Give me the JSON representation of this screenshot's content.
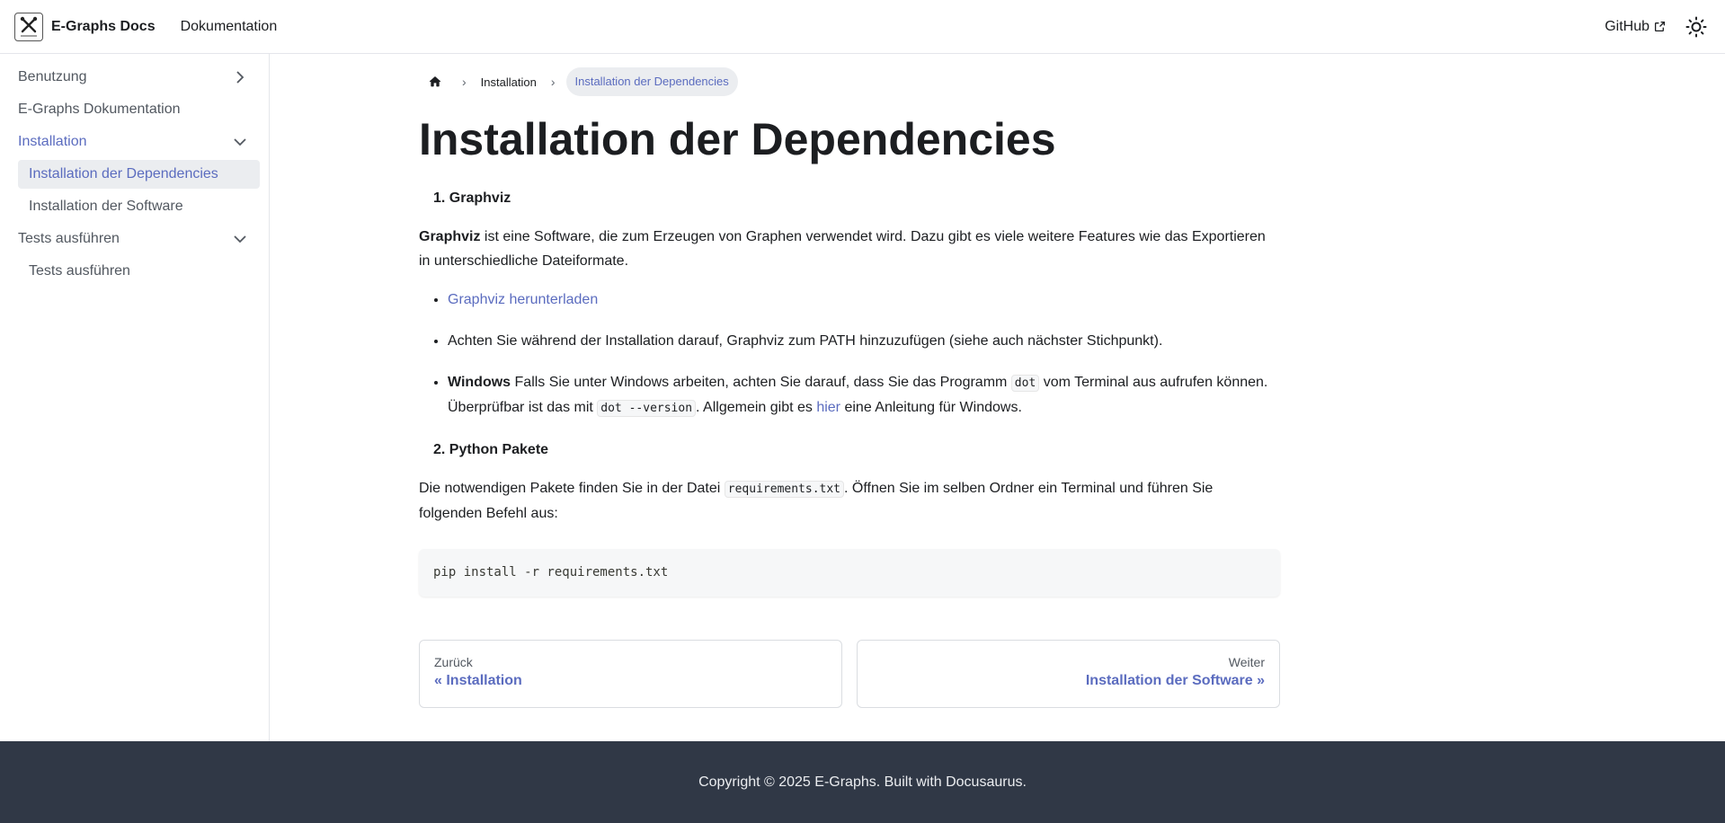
{
  "navbar": {
    "brand_title": "E-Graphs Docs",
    "nav_link": "Dokumentation",
    "github_label": "GitHub"
  },
  "sidebar": {
    "items": [
      {
        "label": "Benutzung"
      },
      {
        "label": "E-Graphs Dokumentation"
      },
      {
        "label": "Installation"
      },
      {
        "label": "Installation der Dependencies"
      },
      {
        "label": "Installation der Software"
      },
      {
        "label": "Tests ausführen"
      },
      {
        "label": "Tests ausführen"
      }
    ]
  },
  "breadcrumb": {
    "parent": "Installation",
    "current": "Installation der Dependencies"
  },
  "page": {
    "title": "Installation der Dependencies",
    "section1": {
      "number": "1.",
      "title": "Graphviz",
      "intro_bold": "Graphviz",
      "intro_text": " ist eine Software, die zum Erzeugen von Graphen verwendet wird. Dazu gibt es viele weitere Features wie das Exportieren in unterschiedliche Dateiformate.",
      "bullet1_link": "Graphviz herunterladen",
      "bullet2": "Achten Sie während der Installation darauf, Graphviz zum PATH hinzuzufügen (siehe auch nächster Stichpunkt).",
      "bullet3_bold": "Windows",
      "bullet3_a": " Falls Sie unter Windows arbeiten, achten Sie darauf, dass Sie das Programm ",
      "bullet3_code1": "dot",
      "bullet3_b": " vom Terminal aus aufrufen können. Überprüfbar ist das mit ",
      "bullet3_code2": "dot --version",
      "bullet3_c": ". Allgemein gibt es ",
      "bullet3_link": "hier",
      "bullet3_d": " eine Anleitung für Windows."
    },
    "section2": {
      "number": "2.",
      "title": "Python Pakete",
      "text_a": "Die notwendigen Pakete finden Sie in der Datei ",
      "code": "requirements.txt",
      "text_b": ". Öffnen Sie im selben Ordner ein Terminal und führen Sie folgenden Befehl aus:",
      "command": "pip install -r requirements.txt"
    }
  },
  "pager": {
    "prev_sub": "Zurück",
    "prev_label": "« Installation",
    "next_sub": "Weiter",
    "next_label": "Installation der Software »"
  },
  "footer": {
    "copyright": "Copyright © 2025 E-Graphs. Built with Docusaurus."
  },
  "colors": {
    "accent": "#5b6cbf",
    "footer_bg": "#303846"
  }
}
